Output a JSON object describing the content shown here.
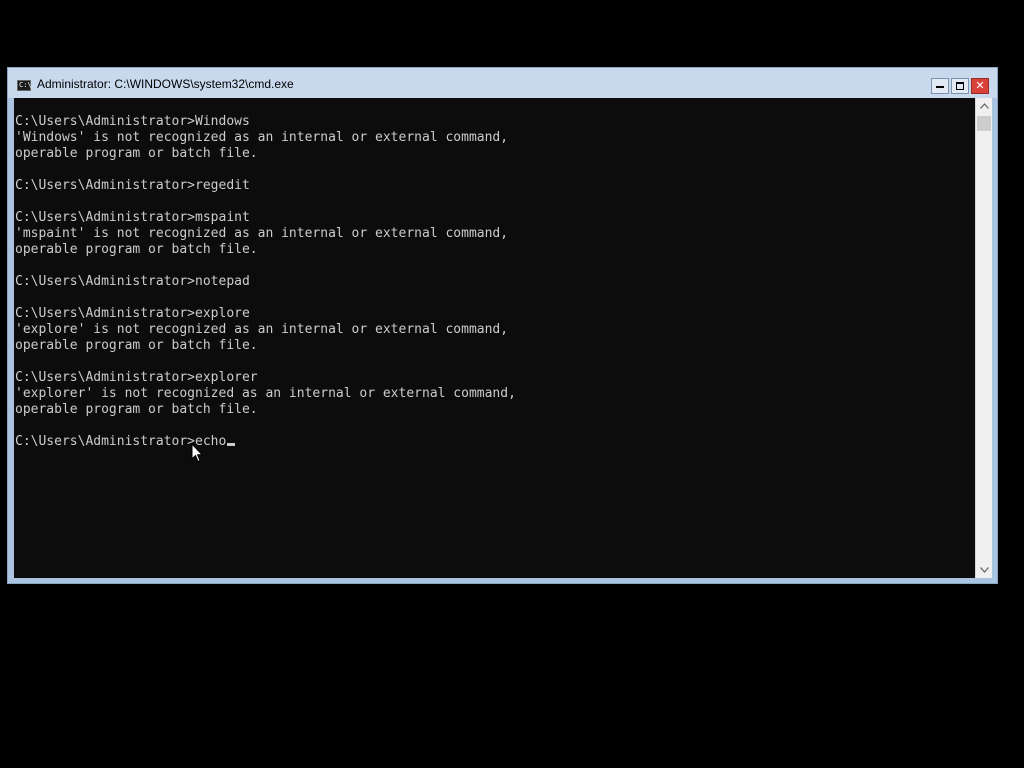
{
  "window": {
    "title": "Administrator: C:\\WINDOWS\\system32\\cmd.exe",
    "icon": "cmd-icon",
    "icon_text": "C:\\",
    "close_glyph": "✕",
    "colors": {
      "frame": "#a9c3e1",
      "titlebar": "#c8d9ee",
      "close_button": "#d9423a",
      "console_background": "#0c0c0c",
      "console_text": "#cccccc"
    }
  },
  "console": {
    "lines": [
      "C:\\Users\\Administrator>Windows",
      "'Windows' is not recognized as an internal or external command,",
      "operable program or batch file.",
      "",
      "C:\\Users\\Administrator>regedit",
      "",
      "C:\\Users\\Administrator>mspaint",
      "'mspaint' is not recognized as an internal or external command,",
      "operable program or batch file.",
      "",
      "C:\\Users\\Administrator>notepad",
      "",
      "C:\\Users\\Administrator>explore",
      "'explore' is not recognized as an internal or external command,",
      "operable program or batch file.",
      "",
      "C:\\Users\\Administrator>explorer",
      "'explorer' is not recognized as an internal or external command,",
      "operable program or batch file.",
      "",
      "C:\\Users\\Administrator>echo"
    ]
  }
}
